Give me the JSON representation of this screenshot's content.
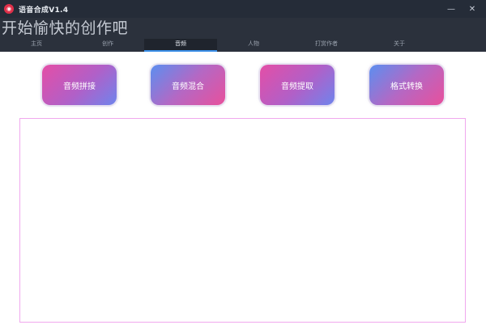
{
  "window": {
    "title": "语音合成V1.4",
    "icon": "app-logo-icon",
    "minimize_glyph": "—",
    "close_glyph": "✕"
  },
  "header": {
    "slogan": "开始愉快的创作吧"
  },
  "tabs": [
    {
      "label": "主页",
      "active": false
    },
    {
      "label": "创作",
      "active": false
    },
    {
      "label": "音频",
      "active": true
    },
    {
      "label": "人物",
      "active": false
    },
    {
      "label": "打赏作者",
      "active": false
    },
    {
      "label": "关于",
      "active": false
    }
  ],
  "audio_tools": [
    {
      "label": "音频拼接"
    },
    {
      "label": "音频混合"
    },
    {
      "label": "音频提取"
    },
    {
      "label": "格式转换"
    }
  ],
  "colors": {
    "titlebar": "#252c38",
    "header": "#2b313c",
    "tab_accent": "#3b8fe8",
    "content_border": "#f0a8ee"
  }
}
